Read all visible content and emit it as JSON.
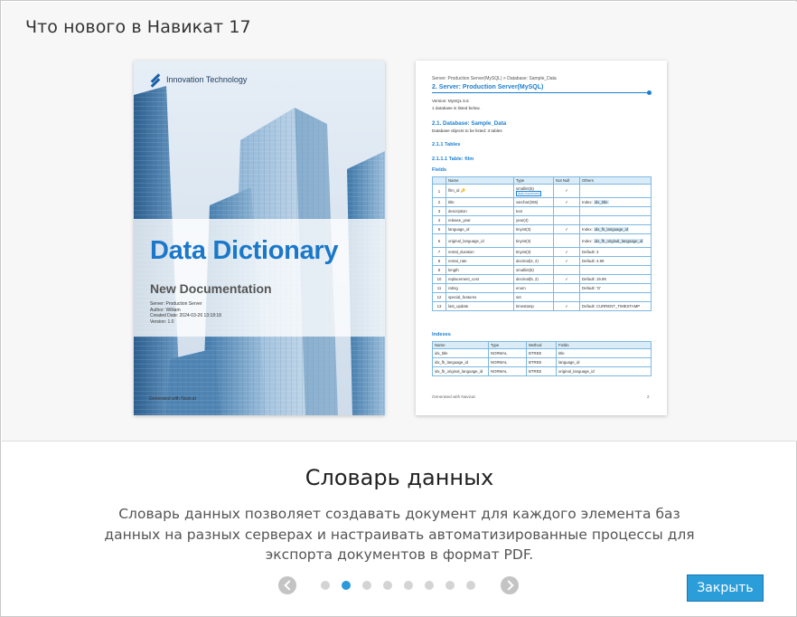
{
  "dialog": {
    "title": "Что нового в Навикат 17"
  },
  "cover": {
    "brand": "Innovation Technology",
    "title": "Data Dictionary",
    "subtitle": "New Documentation",
    "meta": {
      "server": "Server: Production Server",
      "author": "Author: William",
      "created": "Created Date: 2024-03-26 13:18:18",
      "version": "Version: 1.0"
    },
    "footer": "Generated with Navicat"
  },
  "page2": {
    "breadcrumb": "Server: Production Server(MySQL) > Database: Sample_Data",
    "section_title": "2. Server: Production Server(MySQL)",
    "version": "Version: MySQL 5.6",
    "db_count": "1 database is listed below.",
    "db_title": "2.1. Database: Sample_Data",
    "db_objects": "Database objects to be listed: 3 tables",
    "tables_title": "2.1.1 Tables",
    "table_title": "2.1.1.1 Table: film",
    "fields_label": "Fields",
    "fields_headers": [
      "",
      "Name",
      "Type",
      "Not Null",
      "Others"
    ],
    "fields": [
      {
        "n": "1",
        "name": "film_id",
        "type": "smallint(5)",
        "badge": "Auto Increment",
        "nn": "✓",
        "others": ""
      },
      {
        "n": "2",
        "name": "title",
        "type": "varchar(255)",
        "nn": "✓",
        "others_prefix": "Index:",
        "others_tag": "idx_title"
      },
      {
        "n": "3",
        "name": "description",
        "type": "text",
        "nn": "",
        "others": ""
      },
      {
        "n": "4",
        "name": "release_year",
        "type": "year(4)",
        "nn": "",
        "others": ""
      },
      {
        "n": "5",
        "name": "language_id",
        "type": "tinyint(3)",
        "nn": "✓",
        "others_prefix": "Index:",
        "others_tag": "idx_fk_language_id"
      },
      {
        "n": "6",
        "name": "original_language_id",
        "type": "tinyint(3)",
        "nn": "",
        "others_prefix": "Index:",
        "others_tag": "idx_fk_original_language_id"
      },
      {
        "n": "7",
        "name": "rental_duration",
        "type": "tinyint(3)",
        "nn": "✓",
        "others": "Default: 3"
      },
      {
        "n": "8",
        "name": "rental_rate",
        "type": "decimal(4, 2)",
        "nn": "✓",
        "others": "Default: 4.99"
      },
      {
        "n": "9",
        "name": "length",
        "type": "smallint(5)",
        "nn": "",
        "others": ""
      },
      {
        "n": "10",
        "name": "replacement_cost",
        "type": "decimal(5, 2)",
        "nn": "✓",
        "others": "Default: 19.99"
      },
      {
        "n": "11",
        "name": "rating",
        "type": "enum",
        "nn": "",
        "others": "Default: 'G'"
      },
      {
        "n": "12",
        "name": "special_features",
        "type": "set",
        "nn": "",
        "others": ""
      },
      {
        "n": "13",
        "name": "last_update",
        "type": "timestamp",
        "nn": "✓",
        "others": "Default: CURRENT_TIMESTAMP"
      }
    ],
    "indexes_label": "Indexes",
    "indexes_headers": [
      "Name",
      "Type",
      "Method",
      "Fields"
    ],
    "indexes": [
      {
        "name": "idx_title",
        "type": "NORMAL",
        "method": "BTREE",
        "fields": "title"
      },
      {
        "name": "idx_fk_language_id",
        "type": "NORMAL",
        "method": "BTREE",
        "fields": "language_id"
      },
      {
        "name": "idx_fk_original_language_id",
        "type": "NORMAL",
        "method": "BTREE",
        "fields": "original_language_id"
      }
    ],
    "footer": "Generated with Navicat",
    "page_number": "2"
  },
  "feature": {
    "title": "Словарь данных",
    "description": "Словарь данных позволяет создавать документ для каждого элемента баз данных на разных серверах и настраивать автоматизированные процессы для экспорта документов в формат PDF."
  },
  "pager": {
    "total": 8,
    "active_index": 1
  },
  "close_button": {
    "label": "Закрыть"
  },
  "colors": {
    "accent": "#2b9ed9",
    "active_dot": "#2a9ad8",
    "doc_blue": "#1b7fd0"
  }
}
